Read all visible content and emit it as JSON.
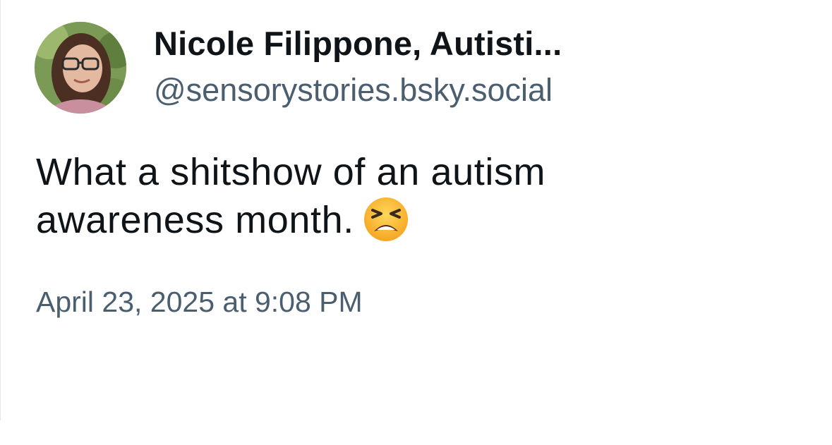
{
  "post": {
    "author_name": "Nicole Filippone, Autisti...",
    "author_handle": "@sensorystories.bsky.social",
    "text_line1": "What a shitshow of an autism",
    "text_line2": "awareness month.",
    "emoji": "tired-face-emoji",
    "timestamp": "April 23, 2025 at 9:08 PM"
  },
  "colors": {
    "name": "#0f1419",
    "secondary": "#4b5e70",
    "background": "#ffffff"
  }
}
